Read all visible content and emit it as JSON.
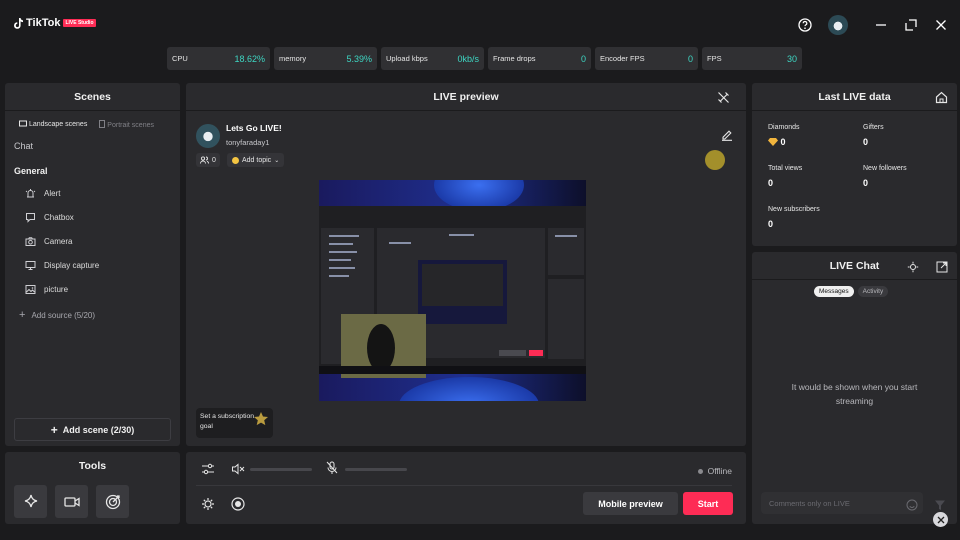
{
  "app": {
    "brand": "TikTok",
    "brand_badge": "LIVE Studio"
  },
  "stats": [
    {
      "label": "CPU",
      "value": "18.62%"
    },
    {
      "label": "memory",
      "value": "5.39%"
    },
    {
      "label": "Upload kbps",
      "value": "0kb/s"
    },
    {
      "label": "Frame drops",
      "value": "0"
    },
    {
      "label": "Encoder FPS",
      "value": "0"
    },
    {
      "label": "FPS",
      "value": "30"
    }
  ],
  "scenes": {
    "title": "Scenes",
    "tab_landscape": "Landscape scenes",
    "tab_portrait": "Portrait scenes",
    "chat_label": "Chat",
    "general_label": "General",
    "sources": [
      {
        "label": "Alert",
        "icon": "alert-icon"
      },
      {
        "label": "Chatbox",
        "icon": "chatbox-icon"
      },
      {
        "label": "Camera",
        "icon": "camera-icon"
      },
      {
        "label": "Display capture",
        "icon": "monitor-icon"
      },
      {
        "label": "picture",
        "icon": "image-icon"
      }
    ],
    "add_source": "Add source (5/20)",
    "add_scene": "Add scene (2/30)"
  },
  "tools": {
    "title": "Tools"
  },
  "preview": {
    "title": "LIVE preview",
    "stream_title": "Lets Go LIVE!",
    "username": "tonyfaraday1",
    "viewers": "0",
    "add_topic": "Add topic",
    "subscription_goal": "Set a subscription goal"
  },
  "controls": {
    "status": "Offline",
    "mobile_preview": "Mobile preview",
    "start": "Start",
    "volume_level": 0.0,
    "mic_level": 0.0
  },
  "last_live": {
    "title": "LIVE data",
    "title_prefix": "Last",
    "metrics": [
      {
        "label": "Diamonds",
        "value": "0"
      },
      {
        "label": "Gifters",
        "value": "0"
      },
      {
        "label": "Total views",
        "value": "0"
      },
      {
        "label": "New followers",
        "value": "0"
      },
      {
        "label": "New subscribers",
        "value": "0"
      }
    ]
  },
  "live_chat": {
    "title": "LIVE Chat",
    "tab_messages": "Messages",
    "tab_activity": "Activity",
    "empty_message": "It would be shown when you start streaming",
    "input_placeholder": "Comments only on LIVE"
  },
  "colors": {
    "accent": "#fe2c55",
    "stat_value": "#3ed6c3",
    "panel": "#2a2a2d",
    "background": "#1b1b1d"
  }
}
